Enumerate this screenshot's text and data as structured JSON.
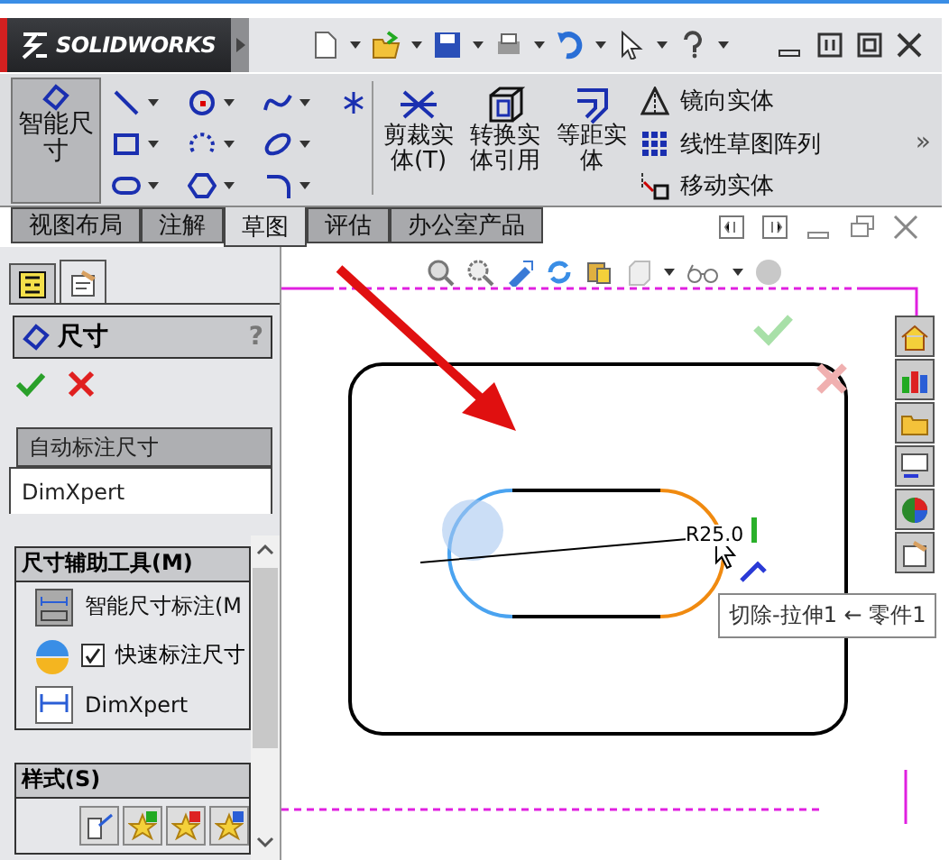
{
  "app": {
    "logo": "SOLIDWORKS"
  },
  "ribbon": {
    "main_button": "智能尺寸",
    "commands": [
      {
        "label": "剪裁实体(T)",
        "kind": "trim"
      },
      {
        "label": "转换实体引用",
        "kind": "convert"
      },
      {
        "label": "等距实体",
        "kind": "offset"
      }
    ],
    "list": [
      {
        "label": "镜向实体",
        "kind": "mirror"
      },
      {
        "label": "线性草图阵列",
        "kind": "pattern"
      },
      {
        "label": "移动实体",
        "kind": "move"
      }
    ],
    "more": "»"
  },
  "tabs": [
    {
      "label": "视图布局",
      "selected": false
    },
    {
      "label": "注解",
      "selected": false
    },
    {
      "label": "草图",
      "selected": true
    },
    {
      "label": "评估",
      "selected": false
    },
    {
      "label": "办公室产品",
      "selected": false
    }
  ],
  "panel": {
    "tabs": [
      {
        "kind": "tree",
        "selected": false
      },
      {
        "kind": "property",
        "selected": true
      }
    ],
    "title": "尺寸",
    "help": "?",
    "subtabs": [
      {
        "label": "自动标注尺寸",
        "selected": false
      },
      {
        "label": "DimXpert",
        "selected": true
      }
    ],
    "tools_title": "尺寸辅助工具(M)",
    "tools": [
      {
        "kind": "button",
        "label": "智能尺寸标注(M"
      },
      {
        "kind": "checkbox",
        "label": "快速标注尺寸",
        "checked": true
      },
      {
        "kind": "dimxpert",
        "label": "DimXpert"
      }
    ],
    "style_title": "样式(S)"
  },
  "canvas": {
    "dimension": "R25.0",
    "tooltip": "切除-拉伸1 ← 零件1"
  }
}
